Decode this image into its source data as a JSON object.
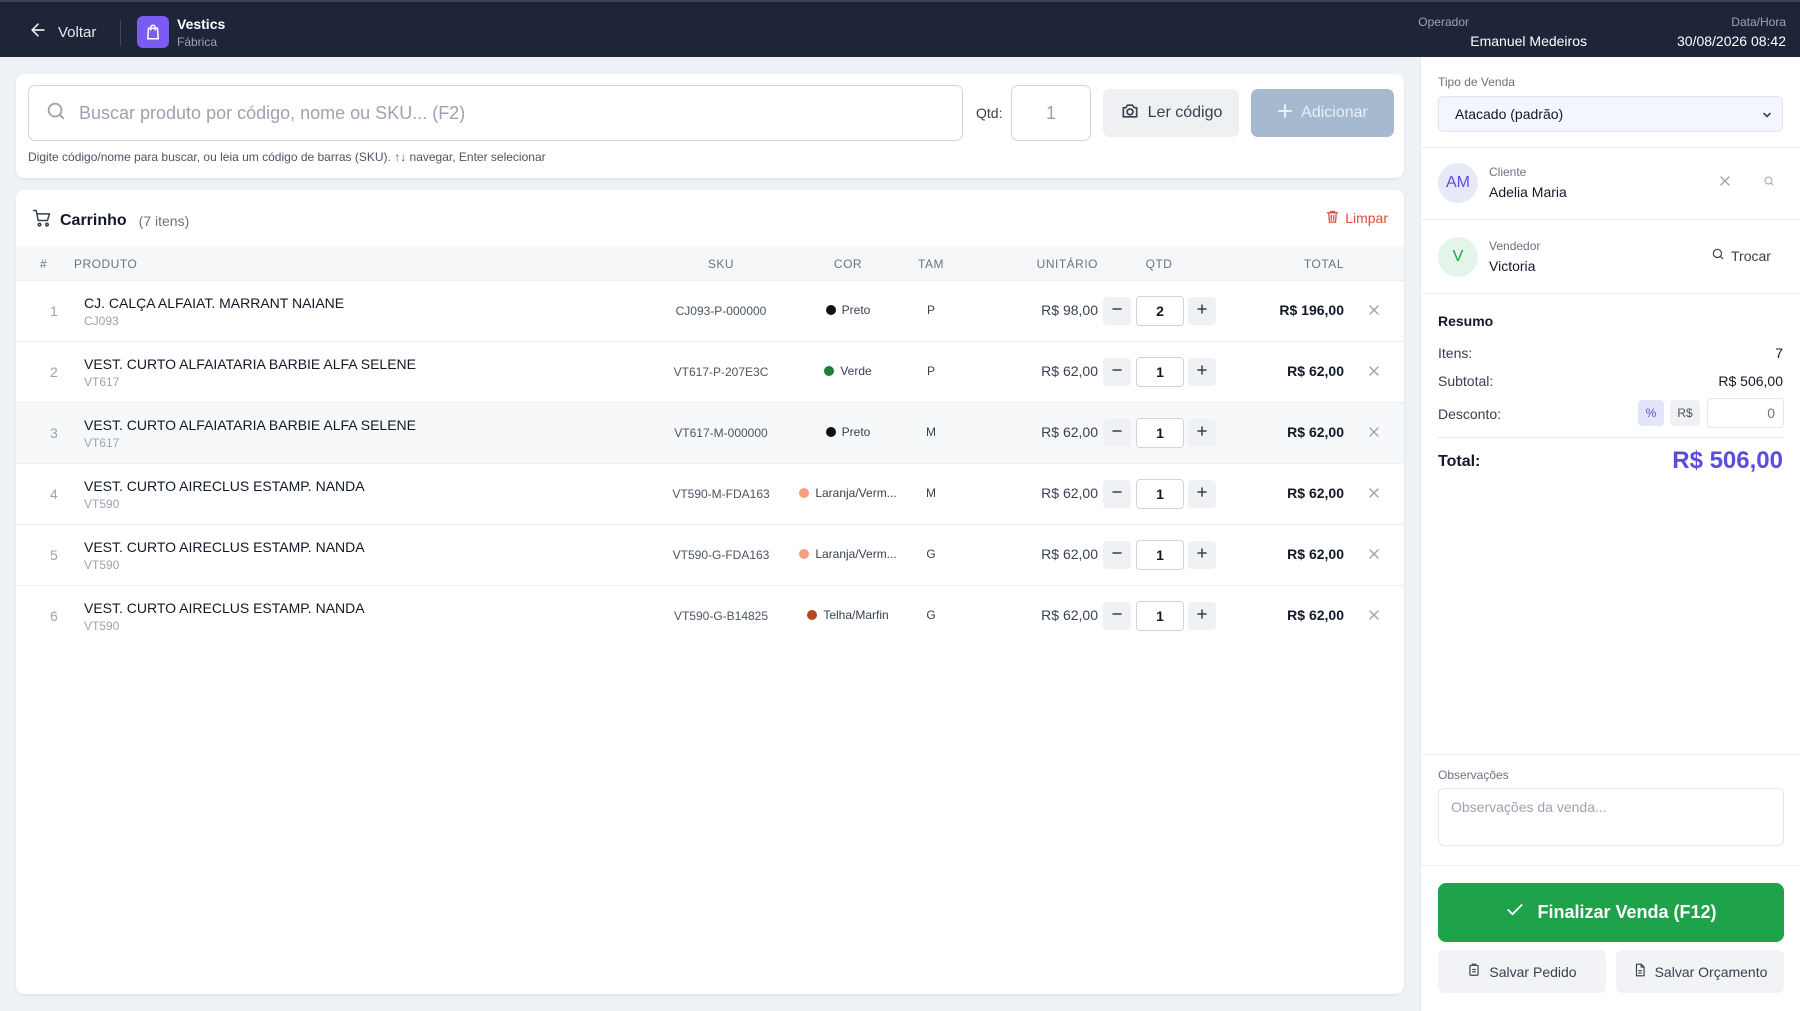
{
  "header": {
    "back_label": "Voltar",
    "brand_name": "Vestics",
    "brand_sub": "Fábrica",
    "operator_label": "Operador",
    "operator_name": "Emanuel Medeiros",
    "datetime_label": "Data/Hora",
    "datetime_value": "30/08/2026 08:42"
  },
  "search": {
    "placeholder": "Buscar produto por código, nome ou SKU... (F2)",
    "value": "",
    "qty_label": "Qtd:",
    "qty_value": "1",
    "read_code_label": "Ler código",
    "add_label": "Adicionar",
    "hint": "Digite código/nome para buscar, ou leia um código de barras (SKU). ↑↓ navegar, Enter selecionar"
  },
  "cart": {
    "title": "Carrinho",
    "count": "(7 itens)",
    "clear_label": "Limpar",
    "columns": {
      "index": "#",
      "product": "PRODUTO",
      "sku": "SKU",
      "color": "COR",
      "size": "TAM",
      "unit": "UNITÁRIO",
      "qty": "QTD",
      "total": "TOTAL"
    },
    "items": [
      {
        "index": "1",
        "name": "CJ. CALÇA ALFAIAT. MARRANT NAIANE",
        "code": "CJ093",
        "sku": "CJ093-P-000000",
        "color": "Preto",
        "color_hex": "#111111",
        "size": "P",
        "unit": "R$ 98,00",
        "qty": "2",
        "total": "R$ 196,00"
      },
      {
        "index": "2",
        "name": "VEST. CURTO ALFAIATARIA BARBIE ALFA SELENE",
        "code": "VT617",
        "sku": "VT617-P-207E3C",
        "color": "Verde",
        "color_hex": "#207e3c",
        "size": "P",
        "unit": "R$ 62,00",
        "qty": "1",
        "total": "R$ 62,00"
      },
      {
        "index": "3",
        "name": "VEST. CURTO ALFAIATARIA BARBIE ALFA SELENE",
        "code": "VT617",
        "sku": "VT617-M-000000",
        "color": "Preto",
        "color_hex": "#111111",
        "size": "M",
        "unit": "R$ 62,00",
        "qty": "1",
        "total": "R$ 62,00"
      },
      {
        "index": "4",
        "name": "VEST. CURTO AIRECLUS ESTAMP. NANDA",
        "code": "VT590",
        "sku": "VT590-M-FDA163",
        "color": "Laranja/Verm...",
        "color_hex": "#f5a07a",
        "size": "M",
        "unit": "R$ 62,00",
        "qty": "1",
        "total": "R$ 62,00"
      },
      {
        "index": "5",
        "name": "VEST. CURTO AIRECLUS ESTAMP. NANDA",
        "code": "VT590",
        "sku": "VT590-G-FDA163",
        "color": "Laranja/Verm...",
        "color_hex": "#f5a07a",
        "size": "G",
        "unit": "R$ 62,00",
        "qty": "1",
        "total": "R$ 62,00"
      },
      {
        "index": "6",
        "name": "VEST. CURTO AIRECLUS ESTAMP. NANDA",
        "code": "VT590",
        "sku": "VT590-G-B14825",
        "color": "Telha/Marfin",
        "color_hex": "#b14825",
        "size": "G",
        "unit": "R$ 62,00",
        "qty": "1",
        "total": "R$ 62,00"
      }
    ]
  },
  "sidebar": {
    "sale_type_label": "Tipo de Venda",
    "sale_type_value": "Atacado (padrão)",
    "client_label": "Cliente",
    "client_initials": "AM",
    "client_name": "Adelia Maria",
    "seller_label": "Vendedor",
    "seller_initial": "V",
    "seller_name": "Victoria",
    "swap_label": "Trocar",
    "summary_title": "Resumo",
    "items_label": "Itens:",
    "items_value": "7",
    "subtotal_label": "Subtotal:",
    "subtotal_value": "R$ 506,00",
    "discount_label": "Desconto:",
    "discount_percent": "%",
    "discount_currency": "R$",
    "discount_value": "0",
    "total_label": "Total:",
    "total_value": "R$ 506,00",
    "notes_label": "Observações",
    "notes_placeholder": "Observações da venda...",
    "finalize_label": "Finalizar Venda (F12)",
    "save_order_label": "Salvar Pedido",
    "save_quote_label": "Salvar Orçamento"
  },
  "colors": {
    "topbar": "#1e2538",
    "brand": "#7c5cf0",
    "accent_total": "#5b4ce0",
    "finalize": "#1ea34a",
    "danger": "#e2483d"
  }
}
